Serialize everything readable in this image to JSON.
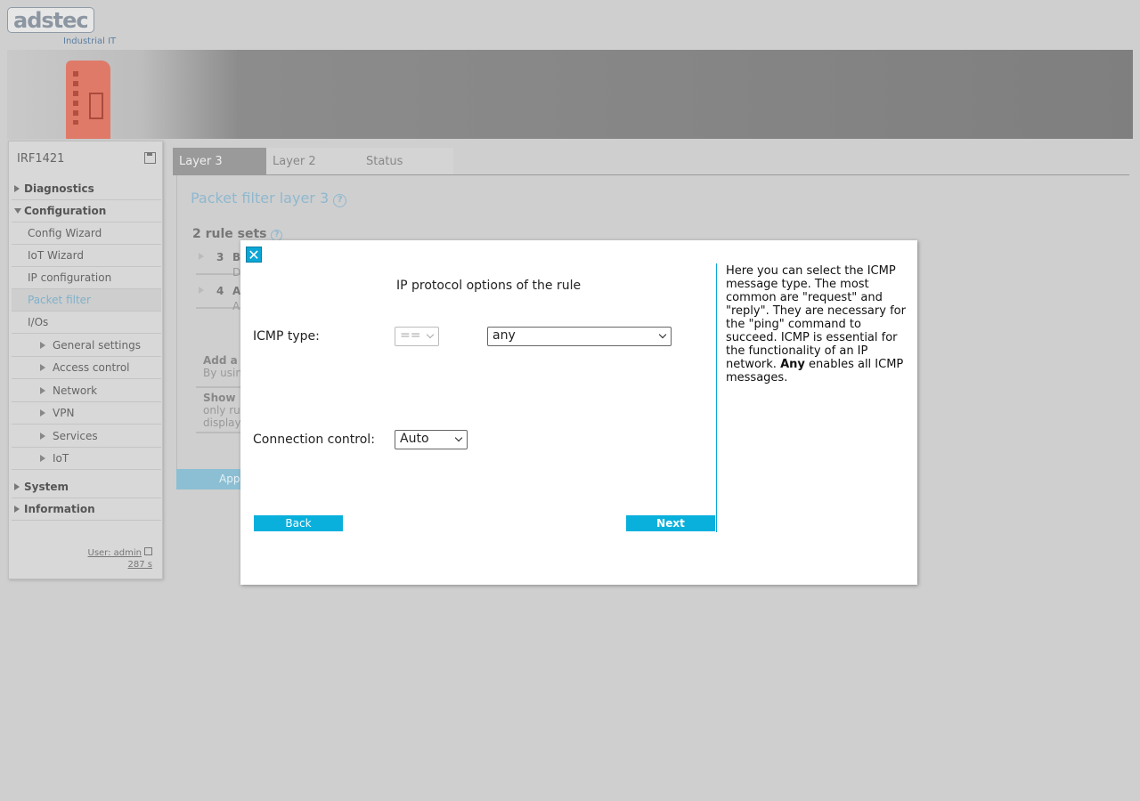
{
  "header": {
    "logo_text": "adstec",
    "logo_subtitle": "Industrial IT"
  },
  "sidebar": {
    "device_name": "IRF1421",
    "items": {
      "diagnostics": "Diagnostics",
      "configuration": "Configuration",
      "config_wizard": "Config Wizard",
      "iot_wizard": "IoT Wizard",
      "ip_configuration": "IP configuration",
      "packet_filter": "Packet filter",
      "ios": "I/Os",
      "general_settings": "General settings",
      "access_control": "Access control",
      "network": "Network",
      "vpn": "VPN",
      "services": "Services",
      "iot": "IoT",
      "system": "System",
      "information": "Information"
    },
    "user": "User: admin",
    "session_time": "287 s"
  },
  "tabs": [
    "Layer 3",
    "Layer 2",
    "Status"
  ],
  "main": {
    "page_title": "Packet filter layer 3",
    "rule_sets_heading": "2 rule sets",
    "rules": [
      {
        "num": "3",
        "name": "B",
        "desc": "D"
      },
      {
        "num": "4",
        "name": "A",
        "desc": "A"
      }
    ],
    "add_box": {
      "title": "Add a",
      "text": "By usin"
    },
    "show_box": {
      "title": "Show",
      "line1": "only ru",
      "line2": "display"
    },
    "apply_label": "Appl"
  },
  "modal": {
    "close_glyph": "✕",
    "title": "IP protocol options of the rule",
    "icmp_label": "ICMP type:",
    "icmp_operator": "==",
    "icmp_value": "any",
    "connection_label": "Connection control:",
    "connection_value": "Auto",
    "back_label": "Back",
    "next_label": "Next",
    "help_text": "Here you can select the ICMP message type. The most common are \"request\" and \"reply\". They are necessary for the \"ping\" command to succeed. ICMP is essential for the functionality of an IP network.",
    "help_bold": "Any",
    "help_tail": " enables all ICMP messages."
  },
  "colors": {
    "accent": "#0ab0dc",
    "link": "#8fb8cf"
  }
}
